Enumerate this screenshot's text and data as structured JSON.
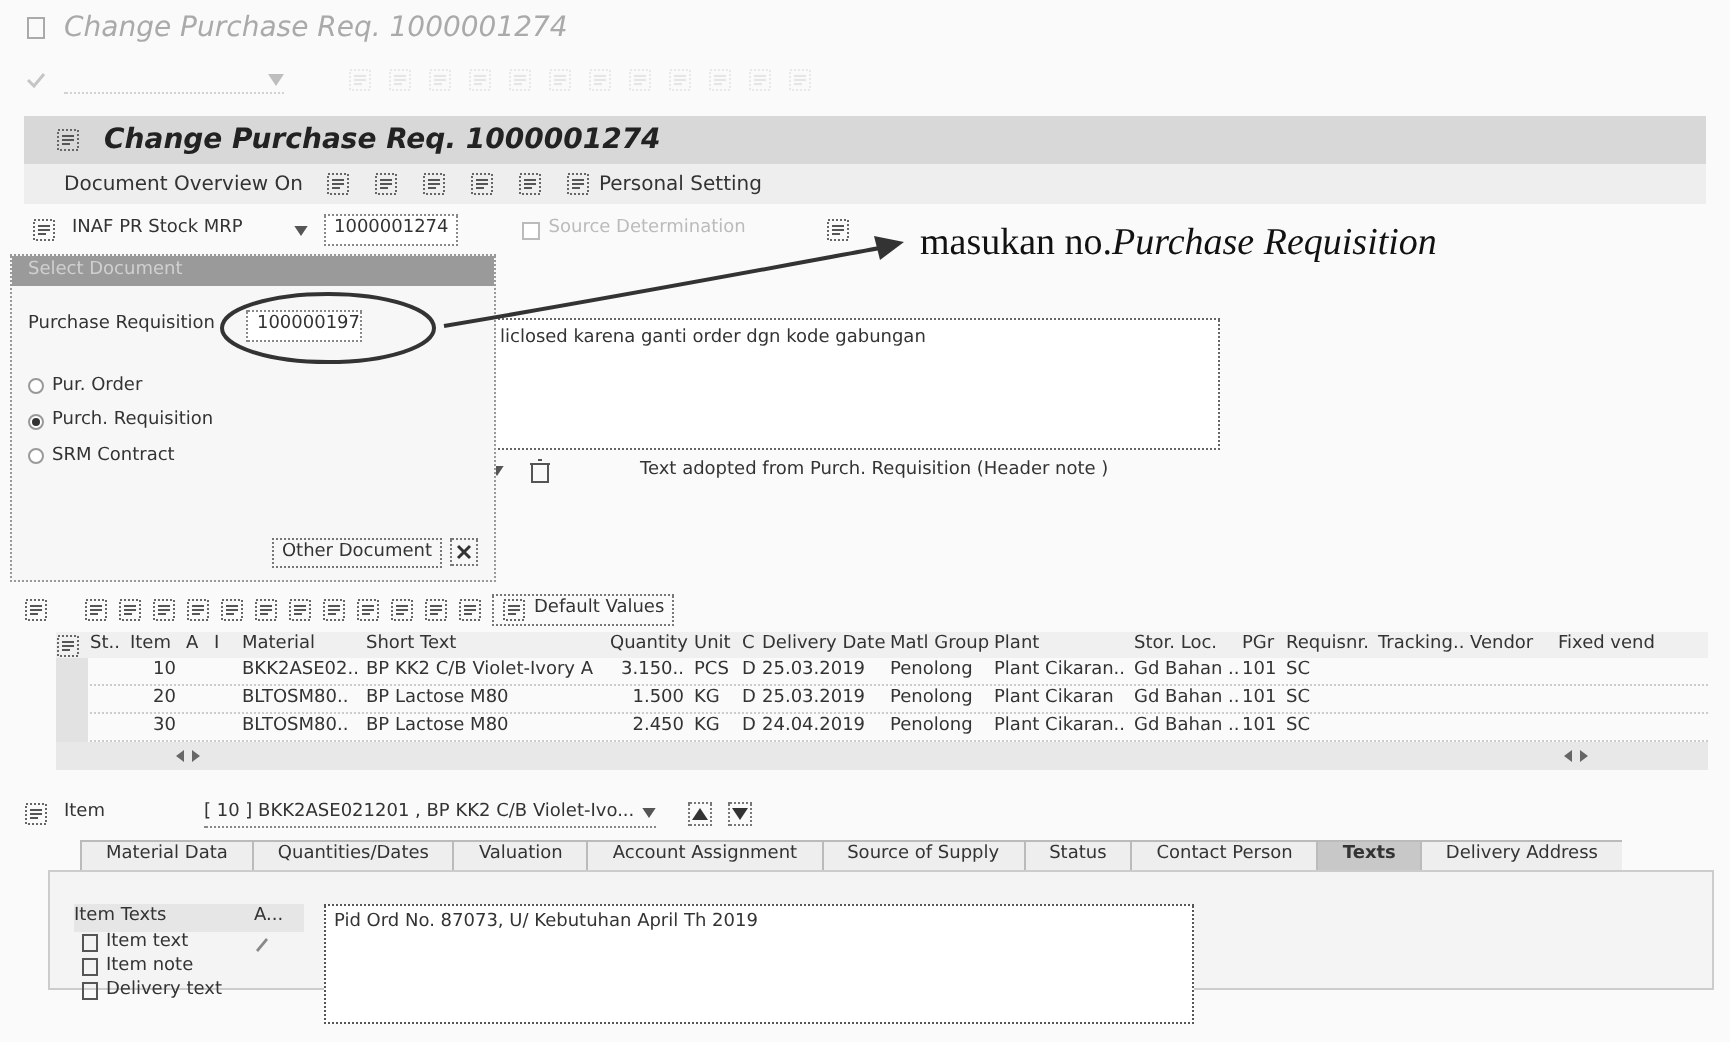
{
  "window": {
    "title": "Change Purchase Req. 1000001274"
  },
  "header": {
    "title": "Change Purchase Req. 1000001274"
  },
  "app_toolbar": {
    "document_overview": "Document Overview On",
    "personal_setting": "Personal Setting"
  },
  "document": {
    "type": "INAF PR Stock MRP",
    "number": "1000001274",
    "source_determination": {
      "label": "Source Determination",
      "checked": false
    }
  },
  "annotation": {
    "text": "masukan no.*Purchase Requisition*"
  },
  "select_document": {
    "title": "Select Document",
    "field_label": "Purchase Requisition",
    "field_value": "100000197",
    "options": [
      {
        "label": "Pur. Order",
        "selected": false
      },
      {
        "label": "Purch. Requisition",
        "selected": true
      },
      {
        "label": "SRM Contract",
        "selected": false
      }
    ],
    "other_document": "Other Document"
  },
  "header_text": {
    "body": "liclosed karena ganti order dgn kode gabungan",
    "status": "Text adopted from Purch. Requisition (Header note )"
  },
  "grid": {
    "default_values": "Default Values",
    "columns": [
      "St..",
      "Item",
      "A",
      "I",
      "Material",
      "Short Text",
      "Quantity",
      "Unit",
      "C",
      "Delivery Date",
      "Matl Group",
      "Plant",
      "Stor. Loc.",
      "PGr",
      "Requisnr.",
      "Tracking..",
      "Vendor",
      "Fixed vend"
    ],
    "rows": [
      [
        "",
        "10",
        "",
        "",
        "BKK2ASE02..",
        "BP KK2 C/B Violet-Ivory A",
        "3.150..",
        "PCS",
        "D",
        "25.03.2019",
        "Penolong",
        "Plant Cikaran..",
        "Gd Bahan ..",
        "101",
        "SC",
        "",
        "",
        ""
      ],
      [
        "",
        "20",
        "",
        "",
        "BLTOSM80..",
        "BP Lactose M80",
        "1.500",
        "KG",
        "D",
        "25.03.2019",
        "Penolong",
        "Plant Cikaran",
        "Gd Bahan ..",
        "101",
        "SC",
        "",
        "",
        ""
      ],
      [
        "",
        "30",
        "",
        "",
        "BLTOSM80..",
        "BP Lactose M80",
        "2.450",
        "KG",
        "D",
        "24.04.2019",
        "Penolong",
        "Plant Cikaran..",
        "Gd Bahan ..",
        "101",
        "SC",
        "",
        "",
        ""
      ]
    ]
  },
  "item": {
    "label": "Item",
    "selector": "[ 10 ] BKK2ASE021201 , BP KK2 C/B Violet-Ivo..."
  },
  "tabs": [
    {
      "label": "Material Data",
      "selected": false
    },
    {
      "label": "Quantities/Dates",
      "selected": false
    },
    {
      "label": "Valuation",
      "selected": false
    },
    {
      "label": "Account Assignment",
      "selected": false
    },
    {
      "label": "Source of Supply",
      "selected": false
    },
    {
      "label": "Status",
      "selected": false
    },
    {
      "label": "Contact Person",
      "selected": false
    },
    {
      "label": "Texts",
      "selected": true
    },
    {
      "label": "Delivery Address",
      "selected": false
    }
  ],
  "item_texts": {
    "column_1": "Item Texts",
    "column_2": "A...",
    "entries": [
      {
        "label": "Item text",
        "adopted": true
      },
      {
        "label": "Item note",
        "adopted": false
      },
      {
        "label": "Delivery text",
        "adopted": false
      }
    ],
    "body": "Pid Ord No. 87073, U/ Kebutuhan April Th 2019"
  }
}
